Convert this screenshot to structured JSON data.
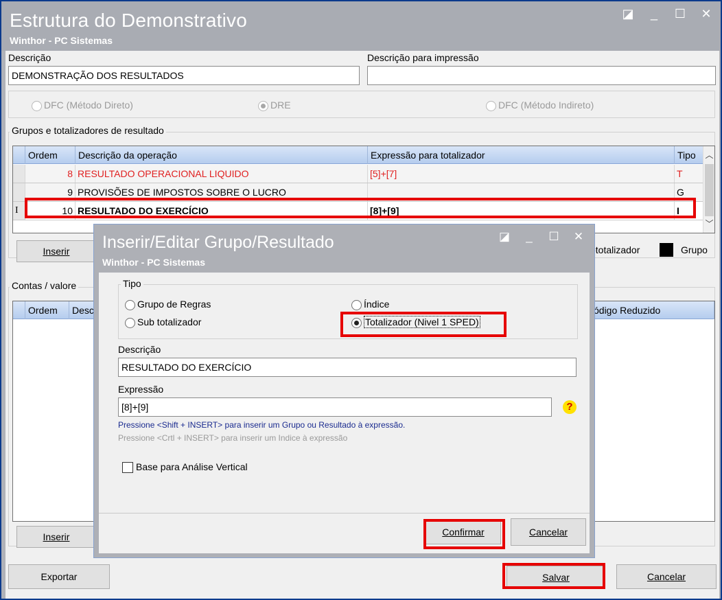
{
  "main": {
    "title": "Estrutura do Demonstrativo",
    "subtitle": "Winthor - PC Sistemas",
    "window_controls": {
      "restore": "◪",
      "minimize": "_",
      "maximize": "☐",
      "close": "✕"
    },
    "descricao_label": "Descrição",
    "descricao_value": "DEMONSTRAÇÃO DOS RESULTADOS",
    "descricao_impressao_label": "Descrição para impressão",
    "descricao_impressao_value": "",
    "radios": {
      "dfc_direto": "DFC (Método Direto)",
      "dre": "DRE",
      "dfc_indireto": "DFC (Método Indireto)",
      "selected": "DRE"
    },
    "grupos_label": "Grupos e totalizadores de resultado",
    "grupos_grid": {
      "headers": [
        "Ordem",
        "Descrição da operação",
        "Expressão para totalizador",
        "Tipo"
      ],
      "rows": [
        {
          "ordem": "8",
          "descricao": "RESULTADO OPERACIONAL LIQUIDO",
          "expressao": "[5]+[7]",
          "tipo": "T",
          "indicator": ""
        },
        {
          "ordem": "9",
          "descricao": "PROVISÕES DE IMPOSTOS SOBRE O LUCRO",
          "expressao": "",
          "tipo": "G",
          "indicator": ""
        },
        {
          "ordem": "10",
          "descricao": "RESULTADO DO EXERCÍCIO",
          "expressao": "[8]+[9]",
          "tipo": "I",
          "indicator": "I"
        }
      ]
    },
    "legend": {
      "subtotalizador": "ototalizador",
      "grupo": "Grupo"
    },
    "inserir_label": "Inserir",
    "contas_label": "Contas / valore",
    "contas_grid": {
      "headers": [
        "Ordem",
        "Desc",
        "ódigo Reduzido"
      ]
    },
    "inserir2_label": "Inserir",
    "exportar_label": "Exportar",
    "salvar_label": "Salvar",
    "cancelar_label": "Cancelar"
  },
  "dialog": {
    "title": "Inserir/Editar Grupo/Resultado",
    "subtitle": "Winthor - PC Sistemas",
    "tipo_label": "Tipo",
    "tipo_options": {
      "grupo_regras": "Grupo de Regras",
      "sub_totalizador": "Sub totalizador",
      "indice": "Índice",
      "totalizador": "Totalizador (Nivel 1 SPED)",
      "selected": "Totalizador (Nivel 1 SPED)"
    },
    "descricao_label": "Descrição",
    "descricao_value": "RESULTADO DO EXERCÍCIO",
    "expressao_label": "Expressão",
    "expressao_value": "[8]+[9]",
    "hint_shift": "Pressione <Shift + INSERT> para inserir um Grupo ou Resultado à expressão.",
    "hint_ctrl": "Pressione <Crtl + INSERT> para inserir um Indice à expressão",
    "help_icon": "?",
    "base_analise_label": "Base para Análise Vertical",
    "base_analise_checked": false,
    "confirmar_label": "Confirmar",
    "cancelar_label": "Cancelar"
  },
  "colors": {
    "titlebar": "#a9acb3",
    "frame": "#0b3a8c",
    "highlight": "#e60000",
    "header": "#b5cdee",
    "red_text": "#e02020"
  }
}
